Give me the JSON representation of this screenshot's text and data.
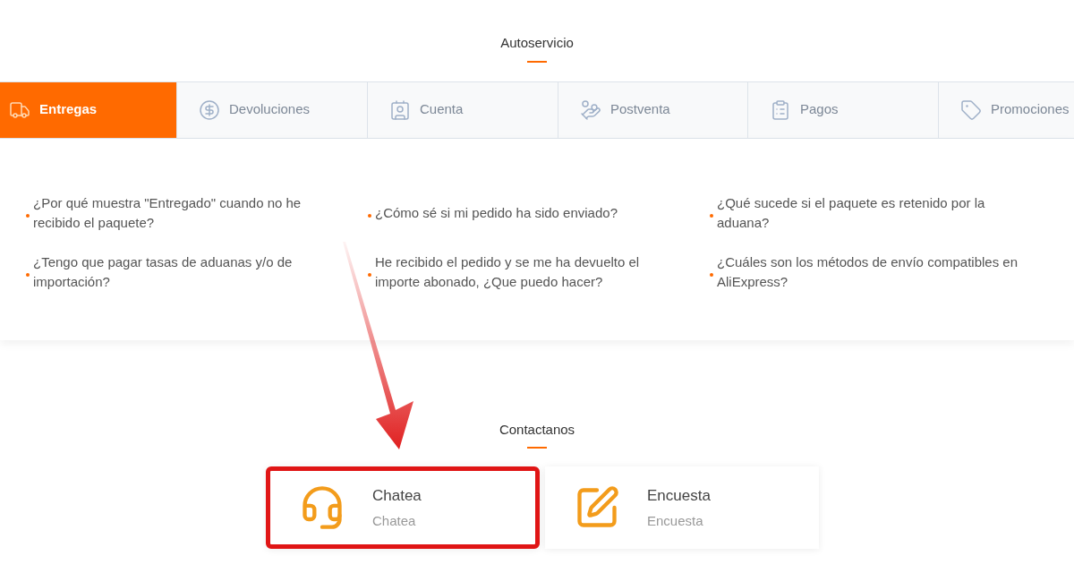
{
  "self_service": {
    "title": "Autoservicio",
    "tabs": [
      {
        "label": "Entregas",
        "selected": true
      },
      {
        "label": "Devoluciones",
        "selected": false
      },
      {
        "label": "Cuenta",
        "selected": false
      },
      {
        "label": "Postventa",
        "selected": false
      },
      {
        "label": "Pagos",
        "selected": false
      },
      {
        "label": "Promociones",
        "selected": false
      }
    ],
    "questions": [
      {
        "text": "¿Por qué muestra \"Entregado\" cuando no he recibido el paquete?"
      },
      {
        "text": "¿Cómo sé si mi pedido ha sido enviado?"
      },
      {
        "text": "¿Qué sucede si el paquete es retenido por la aduana?"
      },
      {
        "text": "¿Tengo que pagar tasas de aduanas y/o de importación?"
      },
      {
        "text": "He recibido el pedido y se me ha devuelto el importe abonado, ¿Que puedo hacer?"
      },
      {
        "text": "¿Cuáles son los métodos de envío compatibles en AliExpress?"
      }
    ]
  },
  "contact": {
    "title": "Contactanos",
    "cards": [
      {
        "kind": "chat",
        "title": "Chatea",
        "subtitle": "Chatea",
        "highlighted": true
      },
      {
        "kind": "survey",
        "title": "Encuesta",
        "subtitle": "Encuesta",
        "highlighted": false
      }
    ]
  }
}
